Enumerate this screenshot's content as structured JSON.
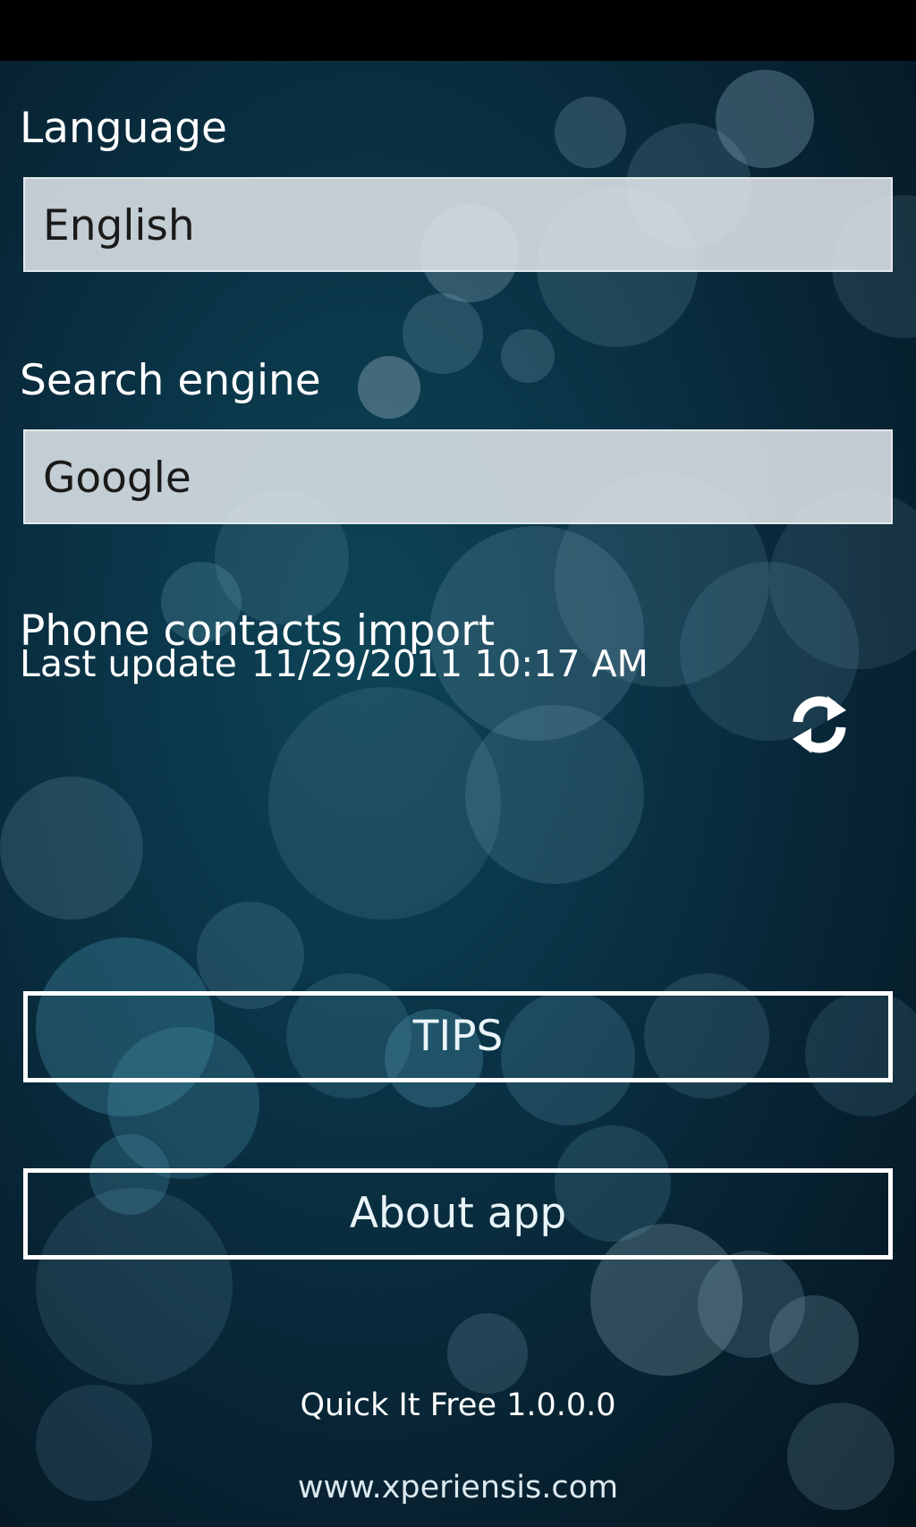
{
  "settings": {
    "language": {
      "label": "Language",
      "value": "English"
    },
    "search_engine": {
      "label": "Search engine",
      "value": "Google"
    },
    "contacts_import": {
      "label": "Phone contacts import",
      "last_update_label": "Last update",
      "last_update_value": "11/29/2011 10:17 AM",
      "refresh_icon": "sync-icon"
    }
  },
  "buttons": {
    "tips_label": "TIPS",
    "about_label": "About app"
  },
  "footer": {
    "version": "Quick It Free 1.0.0.0",
    "website": "www.xperiensis.com"
  },
  "colors": {
    "background": "#0a3346",
    "field_background": "#e2e8ec",
    "text": "#ffffff",
    "button_border": "#ffffff"
  }
}
